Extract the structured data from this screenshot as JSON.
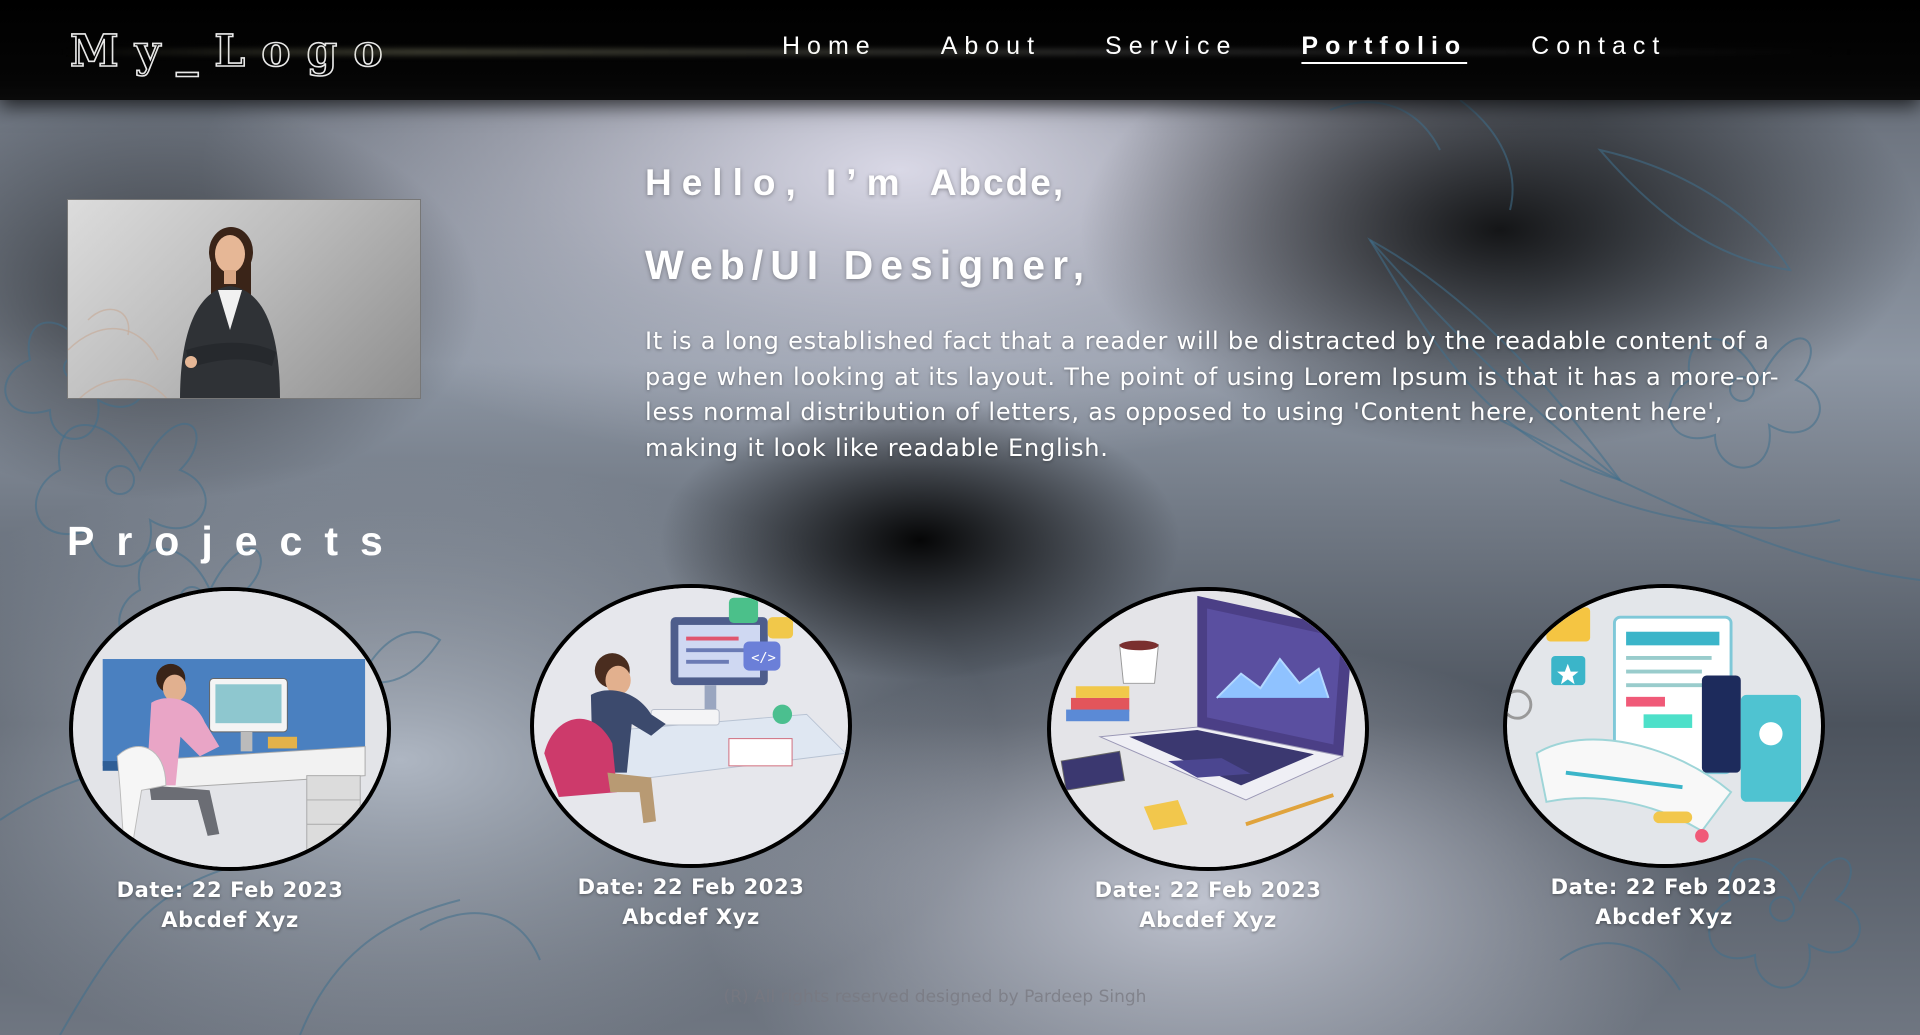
{
  "nav": {
    "logo": "My_Logo",
    "links": [
      {
        "label": "Home"
      },
      {
        "label": "About"
      },
      {
        "label": "Service"
      },
      {
        "label": "Portfolio",
        "active": true
      },
      {
        "label": "Contact"
      }
    ]
  },
  "hero": {
    "greeting_prefix": "Hello, I’m ",
    "greeting_name": "Abcde,",
    "role": "Web/UI Designer,",
    "bio": "It is a long established fact that a reader will be distracted by the readable content of a page when looking at its layout. The point of using Lorem Ipsum is that it has a more-or-less normal distribution of letters, as opposed to using 'Content here, content here', making it look like readable English."
  },
  "projects": {
    "title": "Projects",
    "items": [
      {
        "date": "Date: 22 Feb 2023",
        "name": "Abcdef Xyz"
      },
      {
        "date": "Date: 22 Feb 2023",
        "name": "Abcdef Xyz"
      },
      {
        "date": "Date: 22 Feb 2023",
        "name": "Abcdef Xyz"
      },
      {
        "date": "Date: 22 Feb 2023",
        "name": "Abcdef Xyz"
      }
    ]
  },
  "footer": {
    "text": "(R) All rights reserved designed by Pardeep Singh"
  },
  "colors": {
    "navbar": "#000000",
    "text": "#ffffff",
    "footer_text": "#787880"
  }
}
